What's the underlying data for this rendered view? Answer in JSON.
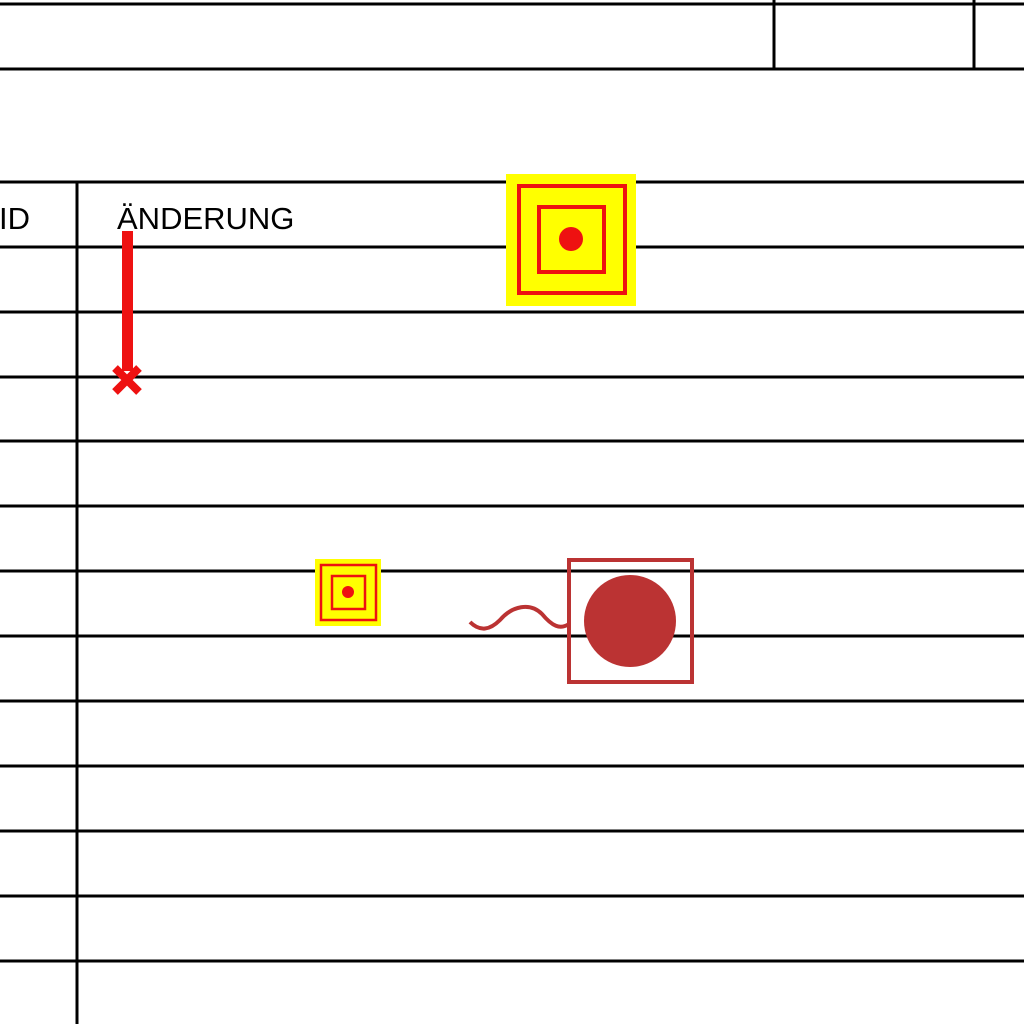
{
  "table": {
    "headers": {
      "id": "ID",
      "change": "ÄNDERUNG"
    },
    "data_rows": 12
  },
  "colors": {
    "grid_line": "#000000",
    "marker_red": "#ee1111",
    "marker_yellow": "#ffff00",
    "symbol_dark_red": "#bb3333"
  },
  "symbols": [
    {
      "icon": "sprinkler-marker-icon"
    },
    {
      "icon": "sprinkler-marker-small-icon"
    },
    {
      "icon": "push-button-icon"
    },
    {
      "icon": "leader-line-icon"
    }
  ]
}
